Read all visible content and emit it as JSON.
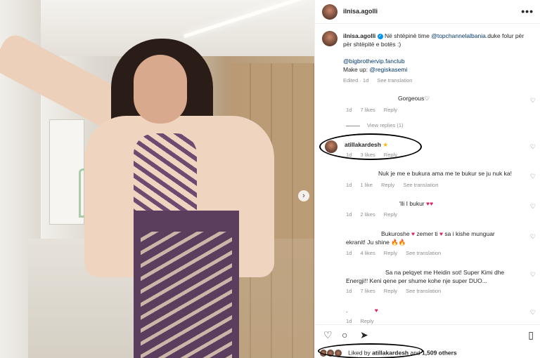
{
  "post": {
    "username": "ilnisa.agolli"
  },
  "caption": {
    "username": "ilnisa.agolli",
    "text_1": "Në shtëpinë time ",
    "mention_1": "@topchannelalbania",
    "text_2": ".duke folur për për shtëpitë e botës :)",
    "mention_2": "@bigbrothervip.fanclub",
    "makeup_label": "Make up: ",
    "mention_3": "@regiskasemi",
    "edited": "Edited · 1d",
    "see_translation": "See translation"
  },
  "comments": [
    {
      "text": "Gorgeous♡",
      "time": "1d",
      "likes": "7 likes",
      "reply": "Reply"
    },
    {
      "view_replies": "View replies (1)"
    },
    {
      "username": "atillakardesh",
      "emoji": "★",
      "time": "1d",
      "likes": "3 likes",
      "reply": "Reply"
    },
    {
      "text": "Nuk je me e bukura ama me te bukur se ju nuk ka!",
      "time": "1d",
      "likes": "1 like",
      "reply": "Reply",
      "translate": "See translation"
    },
    {
      "text": "'lli I bukur",
      "hearts": "♥♥",
      "time": "1d",
      "likes": "2 likes",
      "reply": "Reply"
    },
    {
      "text_a": "Bukuroshe ",
      "text_b": " zemer ti ",
      "text_c": " sa i kishe munguar",
      "line2": "ekranit! Ju shine 🔥🔥",
      "time": "1d",
      "likes": "4 likes",
      "reply": "Reply",
      "translate": "See translation"
    },
    {
      "line1": "Sa na pelqyet me Heidin sot! Super Kimi dhe",
      "line2": "Energji!! Keni qene per shume kohe nje super DUO...",
      "time": "1d",
      "likes": "7 likes",
      "reply": "Reply",
      "translate": "See translation"
    },
    {
      "text": ".",
      "time": "1d",
      "reply": "Reply"
    }
  ],
  "footer": {
    "liked_prefix": "Liked by ",
    "liked_user": "atillakardesh",
    "liked_and": " and ",
    "liked_count": "1,509 others"
  },
  "icons": {
    "more": "more-options-icon",
    "heart": "heart-icon",
    "comment": "comment-icon",
    "share": "share-icon",
    "save": "bookmark-icon",
    "next": "chevron-right-icon"
  },
  "colors": {
    "link": "#00376b",
    "heart_red": "#e0245e",
    "muted": "#8e8e8e",
    "verified": "#0095f6"
  }
}
